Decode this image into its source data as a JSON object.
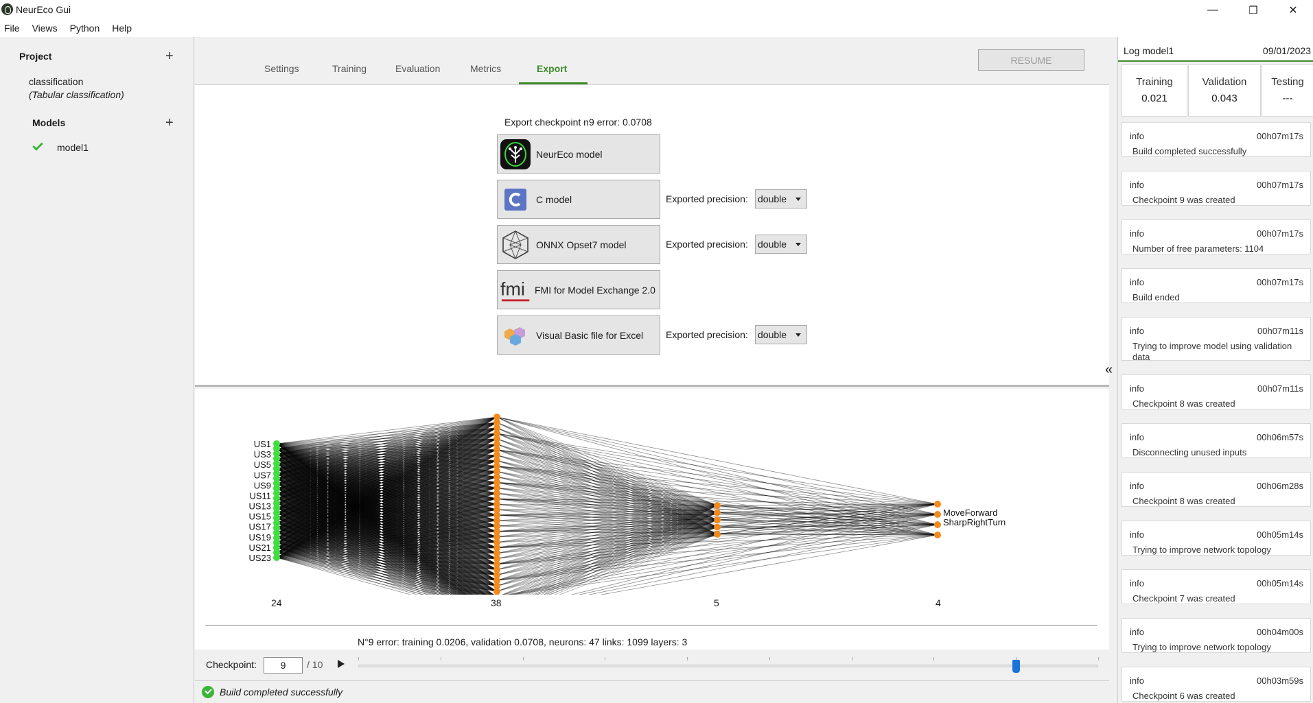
{
  "window": {
    "title": "NeurEco Gui",
    "minimize": "—",
    "maximize": "❐",
    "close": "✕"
  },
  "menu": [
    "File",
    "Views",
    "Python",
    "Help"
  ],
  "left_panel": {
    "project_heading": "Project",
    "project_name": "classification",
    "project_type": "(Tabular classification)",
    "models_heading": "Models",
    "models": [
      {
        "name": "model1",
        "status": "ok"
      }
    ],
    "add_symbol": "+"
  },
  "tabs": [
    {
      "label": "Settings",
      "active": false
    },
    {
      "label": "Training",
      "active": false
    },
    {
      "label": "Evaluation",
      "active": false
    },
    {
      "label": "Metrics",
      "active": false
    },
    {
      "label": "Export",
      "active": true
    }
  ],
  "resume_button": "RESUME",
  "export": {
    "title": "Export checkpoint n9 error: 0.0708",
    "precision_label": "Exported precision:",
    "buttons": [
      {
        "label": "NeurEco model",
        "icon": "neureco-logo-icon",
        "precision": null
      },
      {
        "label": "C model",
        "icon": "c-language-icon",
        "precision": "double"
      },
      {
        "label": "ONNX Opset7 model",
        "icon": "onnx-icon",
        "precision": "double"
      },
      {
        "label": "FMI for Model Exchange 2.0",
        "icon": "fmi-icon",
        "precision": null
      },
      {
        "label": "Visual Basic file for Excel",
        "icon": "visual-basic-icon",
        "precision": "double"
      }
    ]
  },
  "network": {
    "input_labels": [
      "US1",
      "US3",
      "US5",
      "US7",
      "US9",
      "US11",
      "US13",
      "US15",
      "US17",
      "US19",
      "US21",
      "US23"
    ],
    "output_labels": [
      "MoveForward",
      "SharpRightTurn"
    ],
    "layer_counts": [
      "24",
      "38",
      "5",
      "4"
    ],
    "colors": {
      "input": "#3ee03e",
      "hidden": "#f28a1e",
      "links": "#000000"
    }
  },
  "stats_text": "N°9 error: training 0.0206, validation 0.0708,   neurons: 47  links: 1099  layers: 3",
  "checkpoint": {
    "label": "Checkpoint:",
    "value": "9",
    "total": "/ 10",
    "current": 9,
    "max": 10
  },
  "status": {
    "text": "Build completed successfully"
  },
  "log": {
    "title": "Log model1",
    "date": "09/01/2023",
    "metrics": [
      {
        "name": "Training",
        "value": "0.021"
      },
      {
        "name": "Validation",
        "value": "0.043"
      },
      {
        "name": "Testing",
        "value": "---"
      }
    ],
    "entries": [
      {
        "level": "info",
        "time": "00h07m17s",
        "message": "Build completed successfully"
      },
      {
        "level": "info",
        "time": "00h07m17s",
        "message": "Checkpoint 9 was created"
      },
      {
        "level": "info",
        "time": "00h07m17s",
        "message": "Number of free parameters: 1104"
      },
      {
        "level": "info",
        "time": "00h07m17s",
        "message": "Build ended"
      },
      {
        "level": "info",
        "time": "00h07m11s",
        "message": "Trying to improve model using validation data"
      },
      {
        "level": "info",
        "time": "00h07m11s",
        "message": "Checkpoint 8 was created"
      },
      {
        "level": "info",
        "time": "00h06m57s",
        "message": "Disconnecting unused inputs"
      },
      {
        "level": "info",
        "time": "00h06m28s",
        "message": "Checkpoint 8 was created"
      },
      {
        "level": "info",
        "time": "00h05m14s",
        "message": "Trying to improve network topology"
      },
      {
        "level": "info",
        "time": "00h05m14s",
        "message": "Checkpoint 7 was created"
      },
      {
        "level": "info",
        "time": "00h04m00s",
        "message": "Trying to improve network topology"
      },
      {
        "level": "info",
        "time": "00h03m59s",
        "message": "Checkpoint 6 was created"
      }
    ]
  }
}
